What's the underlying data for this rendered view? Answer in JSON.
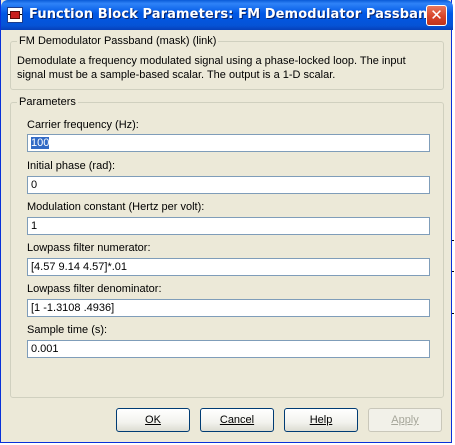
{
  "window": {
    "title": "Function Block Parameters: FM Demodulator Passband",
    "close_symbol": "✕"
  },
  "description_group": {
    "legend": "FM Demodulator Passband (mask) (link)",
    "text": "Demodulate a frequency modulated signal using a phase-locked loop. The input signal must be a sample-based scalar. The output is a 1-D scalar."
  },
  "parameters_group": {
    "legend": "Parameters",
    "fields": [
      {
        "label": "Carrier frequency (Hz):",
        "value": "100"
      },
      {
        "label": "Initial phase (rad):",
        "value": "0"
      },
      {
        "label": "Modulation constant (Hertz per volt):",
        "value": "1"
      },
      {
        "label": "Lowpass filter numerator:",
        "value": "[4.57 9.14 4.57]*.01"
      },
      {
        "label": "Lowpass filter denominator:",
        "value": "[1 -1.3108 .4936]"
      },
      {
        "label": "Sample time (s):",
        "value": "0.001"
      }
    ]
  },
  "buttons": {
    "ok": "OK",
    "cancel": "Cancel",
    "help": "Help",
    "apply": "Apply"
  }
}
